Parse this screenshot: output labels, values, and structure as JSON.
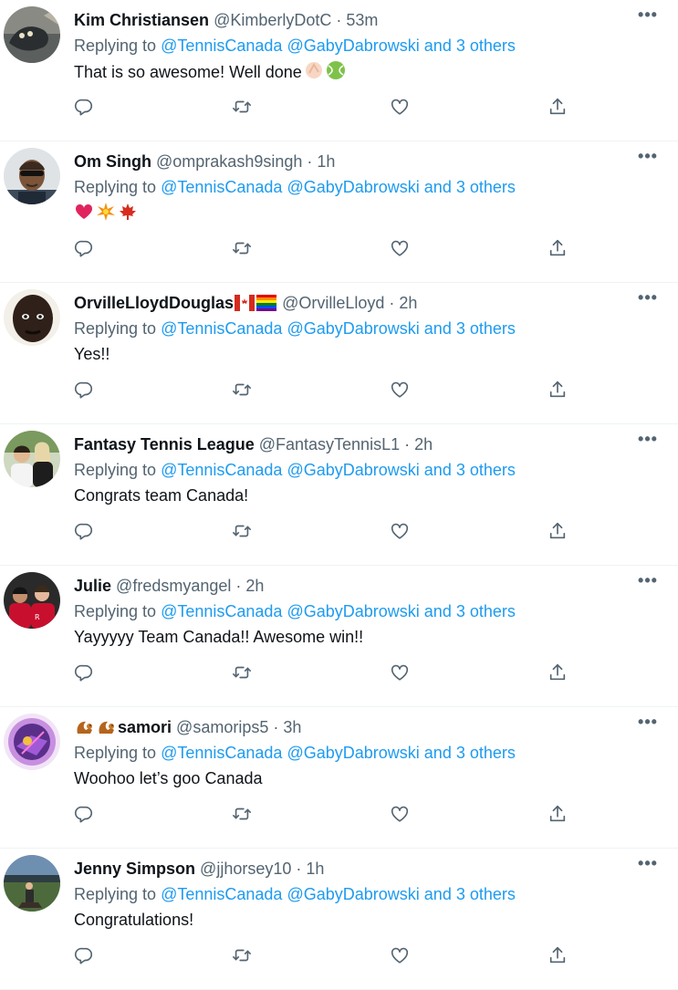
{
  "reply_prefix": "Replying to",
  "replying_to": [
    "@TennisCanada",
    "@GabyDabrowski",
    "and 3 others"
  ],
  "tweets": [
    {
      "name": "Kim Christiansen",
      "handle": "@KimberlyDotC",
      "time": "53m",
      "text": "That is so awesome! Well done"
    },
    {
      "name": "Om Singh",
      "handle": "@omprakash9singh",
      "time": "1h",
      "text": ""
    },
    {
      "name": "OrvilleLloydDouglas",
      "handle": "@OrvilleLloyd",
      "time": "2h",
      "text": "Yes!!"
    },
    {
      "name": "Fantasy Tennis League",
      "handle": "@FantasyTennisL1",
      "time": "2h",
      "text": "Congrats team Canada!"
    },
    {
      "name": "Julie",
      "handle": "@fredsmyangel",
      "time": "2h",
      "text": "Yayyyyy Team Canada!! Awesome win!!"
    },
    {
      "name": "samori",
      "handle": "@samorips5",
      "time": "3h",
      "text": "Woohoo let’s goo Canada"
    },
    {
      "name": "Jenny Simpson",
      "handle": "@jjhorsey10",
      "time": "1h",
      "text": "Congratulations!"
    }
  ],
  "more_label": "•••",
  "separator": "·",
  "icons": {
    "reply": "reply-icon",
    "retweet": "retweet-icon",
    "like": "heart-icon",
    "share": "share-icon"
  },
  "colors": {
    "link": "#1d9bf0",
    "muted": "#536471",
    "text": "#0f1419",
    "divider": "#eff3f4"
  }
}
